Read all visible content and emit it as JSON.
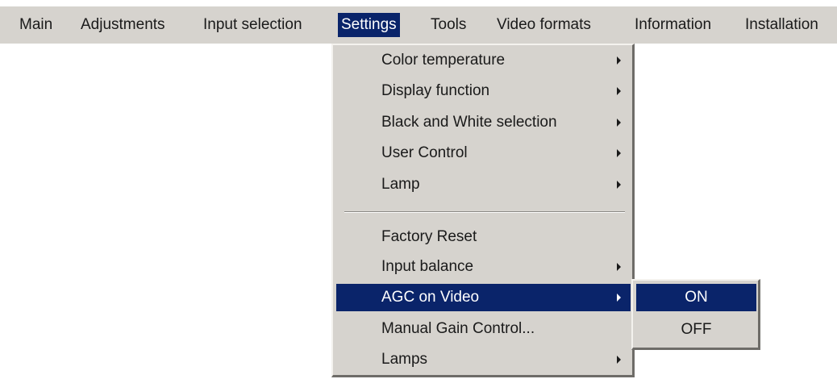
{
  "menubar": {
    "items": [
      {
        "label": "Main"
      },
      {
        "label": "Adjustments"
      },
      {
        "label": "Input selection"
      },
      {
        "label": "Settings",
        "active": true
      },
      {
        "label": "Tools"
      },
      {
        "label": "Video formats"
      },
      {
        "label": "Information"
      },
      {
        "label": "Installation"
      }
    ]
  },
  "settings_menu": {
    "group1": [
      {
        "label": "Color temperature",
        "has_submenu": true
      },
      {
        "label": "Display function",
        "has_submenu": true
      },
      {
        "label": "Black and White selection",
        "has_submenu": true
      },
      {
        "label": "User Control",
        "has_submenu": true
      },
      {
        "label": "Lamp",
        "has_submenu": true
      }
    ],
    "group2": [
      {
        "label": "Factory Reset",
        "has_submenu": false
      },
      {
        "label": "Input balance",
        "has_submenu": true
      },
      {
        "label": "AGC on Video",
        "has_submenu": true,
        "active": true
      },
      {
        "label": "Manual Gain Control...",
        "has_submenu": false
      },
      {
        "label": "Lamps",
        "has_submenu": true
      }
    ]
  },
  "agc_submenu": {
    "items": [
      {
        "label": "ON",
        "active": true
      },
      {
        "label": "OFF"
      }
    ]
  },
  "colors": {
    "menu_background": "#d6d3ce",
    "highlight": "#0a246a",
    "highlight_text": "#ffffff"
  },
  "icons": {
    "submenu_arrow": "submenu-arrow-icon"
  }
}
